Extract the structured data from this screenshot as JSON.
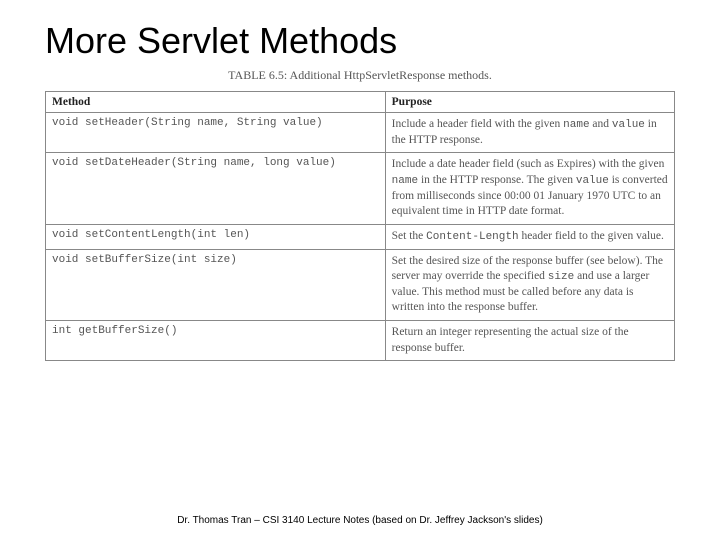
{
  "title": "More Servlet Methods",
  "caption": "TABLE 6.5: Additional HttpServletResponse methods.",
  "headers": {
    "method": "Method",
    "purpose": "Purpose"
  },
  "rows": [
    {
      "signature": "void setHeader(String name, String value)",
      "purpose_html": "Include a header field with the given <span class=\"tt\">name</span> and <span class=\"tt\">value</span> in the HTTP response."
    },
    {
      "signature": "void setDateHeader(String name, long value)",
      "purpose_html": "Include a date header field (such as Expires) with the given <span class=\"tt\">name</span> in the HTTP response. The given <span class=\"tt\">value</span> is converted from milliseconds since 00:00 01 January 1970 UTC to an equivalent time in HTTP date format."
    },
    {
      "signature": "void setContentLength(int len)",
      "purpose_html": "Set the <span class=\"tt\">Content-Length</span> header field to the given value."
    },
    {
      "signature": "void setBufferSize(int size)",
      "purpose_html": "Set the desired size of the response buffer (see below). The server may override the specified <span class=\"tt\">size</span> and use a larger value. This method must be called before any data is written into the response buffer."
    },
    {
      "signature": "int getBufferSize()",
      "purpose_html": "Return an integer representing the actual size of the response buffer."
    }
  ],
  "footer": "Dr. Thomas Tran – CSI 3140 Lecture Notes (based on Dr. Jeffrey Jackson's slides)"
}
